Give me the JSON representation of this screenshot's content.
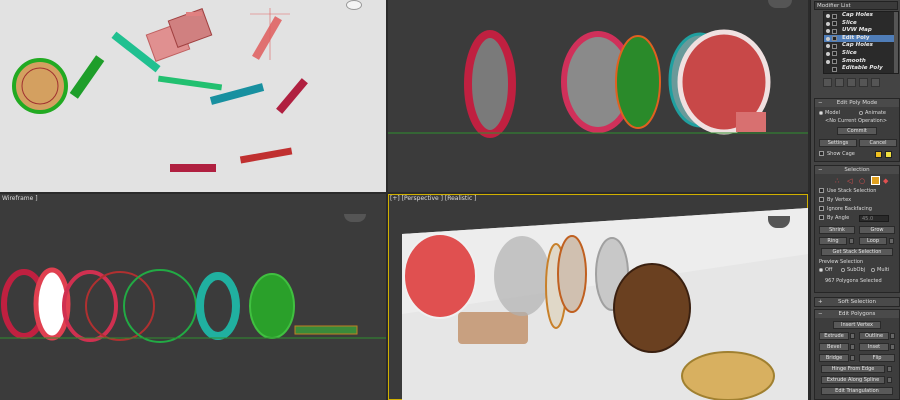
{
  "viewports": {
    "top": {
      "label": ""
    },
    "front": {
      "label": ""
    },
    "left": {
      "label": "Wireframe ]"
    },
    "perspective": {
      "label": "[+] [Perspective ] [Realistic ]"
    }
  },
  "colors": {
    "accent_selected": "#4f7db8",
    "active_viewport": "#d0b000",
    "ground_line": "#2f8f2f"
  },
  "panel": {
    "modifier_list": "Modifier List",
    "stack": [
      {
        "label": "Cap Holes",
        "selected": false
      },
      {
        "label": "Slice",
        "selected": false
      },
      {
        "label": "UVW Map",
        "selected": false
      },
      {
        "label": "Edit Poly",
        "selected": true
      },
      {
        "label": "Cap Holes",
        "selected": false
      },
      {
        "label": "Slice",
        "selected": false
      },
      {
        "label": "Smooth",
        "selected": false
      },
      {
        "label": "Editable Poly",
        "selected": false
      }
    ],
    "edit_poly_mode": {
      "title": "Edit Poly Mode",
      "model": "Model",
      "animate": "Animate",
      "no_op": "<No Current Operation>",
      "commit": "Commit",
      "settings": "Settings",
      "cancel": "Cancel",
      "show_cage": "Show Cage"
    },
    "selection": {
      "title": "Selection",
      "use_stack": "Use Stack Selection",
      "by_vertex": "By Vertex",
      "ignore_backfacing": "Ignore Backfacing",
      "by_angle": "By Angle",
      "angle_value": "45.0",
      "shrink": "Shrink",
      "grow": "Grow",
      "ring": "Ring",
      "loop": "Loop",
      "get_stack": "Get Stack Selection",
      "preview": "Preview Selection",
      "off": "Off",
      "subobj": "SubObj",
      "multi": "Multi",
      "status": "967 Polygons Selected"
    },
    "soft_selection": {
      "title": "Soft Selection"
    },
    "edit_polygons": {
      "title": "Edit Polygons",
      "insert_vertex": "Insert Vertex",
      "extrude": "Extrude",
      "outline": "Outline",
      "bevel": "Bevel",
      "inset": "Inset",
      "bridge": "Bridge",
      "flip": "Flip",
      "hinge": "Hinge From Edge",
      "extrude_spline": "Extrude Along Spline",
      "edit_triangulation": "Edit Triangulation"
    }
  }
}
